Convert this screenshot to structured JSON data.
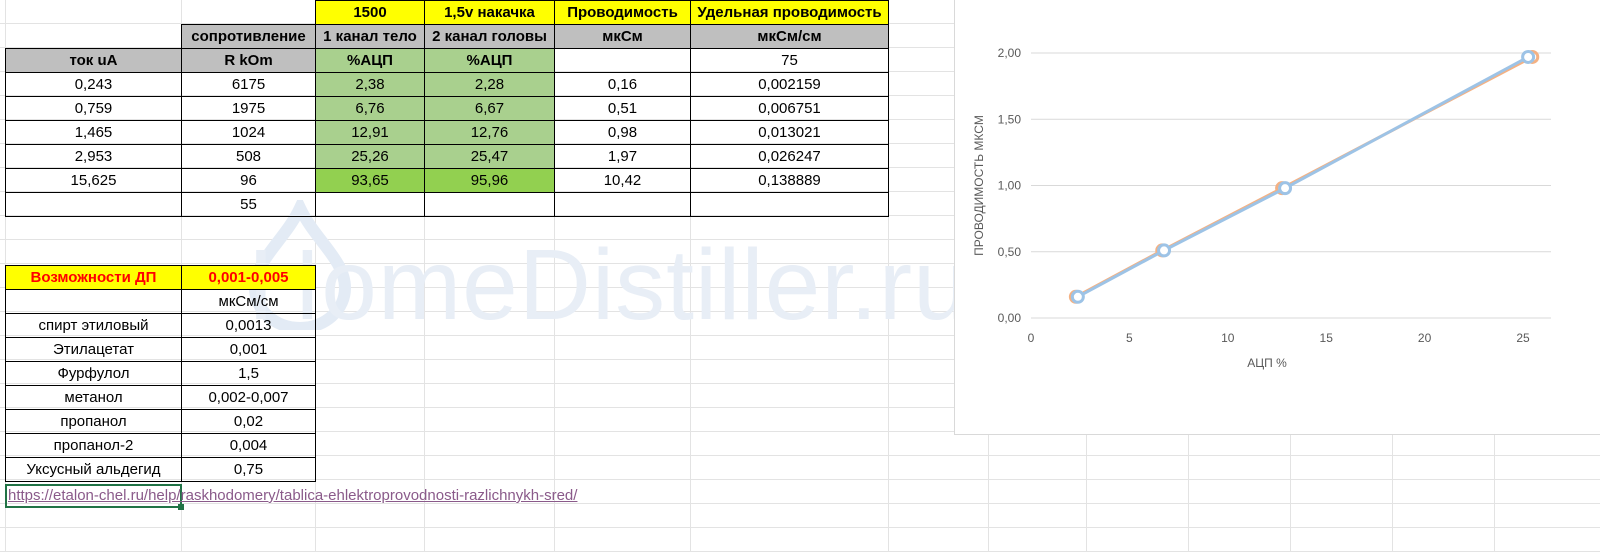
{
  "table": {
    "title_row": [
      "",
      "",
      "1500",
      "1,5v накачка",
      "Проводимость",
      "Удельная проводимость"
    ],
    "header_row": [
      "",
      "сопротивление",
      "1 канал тело",
      "2 канал головы",
      "мкСм",
      "мкСм/см"
    ],
    "units_row": [
      "ток uA",
      "R  kOm",
      "%АЦП",
      "%АЦП",
      "",
      "75"
    ],
    "rows": [
      [
        "0,243",
        "6175",
        "2,38",
        "2,28",
        "0,16",
        "0,002159"
      ],
      [
        "0,759",
        "1975",
        "6,76",
        "6,67",
        "0,51",
        "0,006751"
      ],
      [
        "1,465",
        "1024",
        "12,91",
        "12,76",
        "0,98",
        "0,013021"
      ],
      [
        "2,953",
        "508",
        "25,26",
        "25,47",
        "1,97",
        "0,026247"
      ],
      [
        "15,625",
        "96",
        "93,65",
        "95,96",
        "10,42",
        "0,138889"
      ],
      [
        "",
        "55",
        "",
        "",
        "",
        ""
      ]
    ]
  },
  "dp_table": {
    "title": "Возможности ДП",
    "range": "0,001-0,005",
    "unit": "мкСм/см",
    "rows": [
      [
        "спирт этиловый",
        "0,0013"
      ],
      [
        "Этилацетат",
        "0,001"
      ],
      [
        "Фурфулол",
        "1,5"
      ],
      [
        "метанол",
        "0,002-0,007"
      ],
      [
        "пропанол",
        "0,02"
      ],
      [
        "пропанол-2",
        "0,004"
      ],
      [
        "Уксусный альдегид",
        "0,75"
      ]
    ]
  },
  "link_text": "https://etalon-chel.ru/help/raskhodomery/tablica-ehlektroprovodnosti-razlichnykh-sred/",
  "watermark": "HomeDistiller.ru",
  "colors": {
    "yellow": "#ffff00",
    "gray_header": "#bfbfbf",
    "green_light": "#a9d08e",
    "green_bright": "#92d050",
    "series_blue": "#9dc3e6",
    "series_orange": "#f4b183"
  },
  "chart_data": {
    "type": "line",
    "title": "",
    "xlabel": "АЦП %",
    "ylabel": "ПРОВОДИМОСТЬ МКСМ",
    "xlim": [
      0,
      25
    ],
    "ylim": [
      0,
      2
    ],
    "x_ticks": [
      "0",
      "5",
      "10",
      "15",
      "20",
      "25"
    ],
    "y_ticks": [
      "0,00",
      "0,50",
      "1,00",
      "1,50",
      "2,00"
    ],
    "series": [
      {
        "color": "#f4b183",
        "x": [
          2.28,
          6.67,
          12.76,
          25.47
        ],
        "y": [
          0.16,
          0.51,
          0.98,
          1.97
        ]
      },
      {
        "color": "#9dc3e6",
        "x": [
          2.38,
          6.76,
          12.91,
          25.26
        ],
        "y": [
          0.16,
          0.51,
          0.98,
          1.97
        ]
      }
    ]
  }
}
